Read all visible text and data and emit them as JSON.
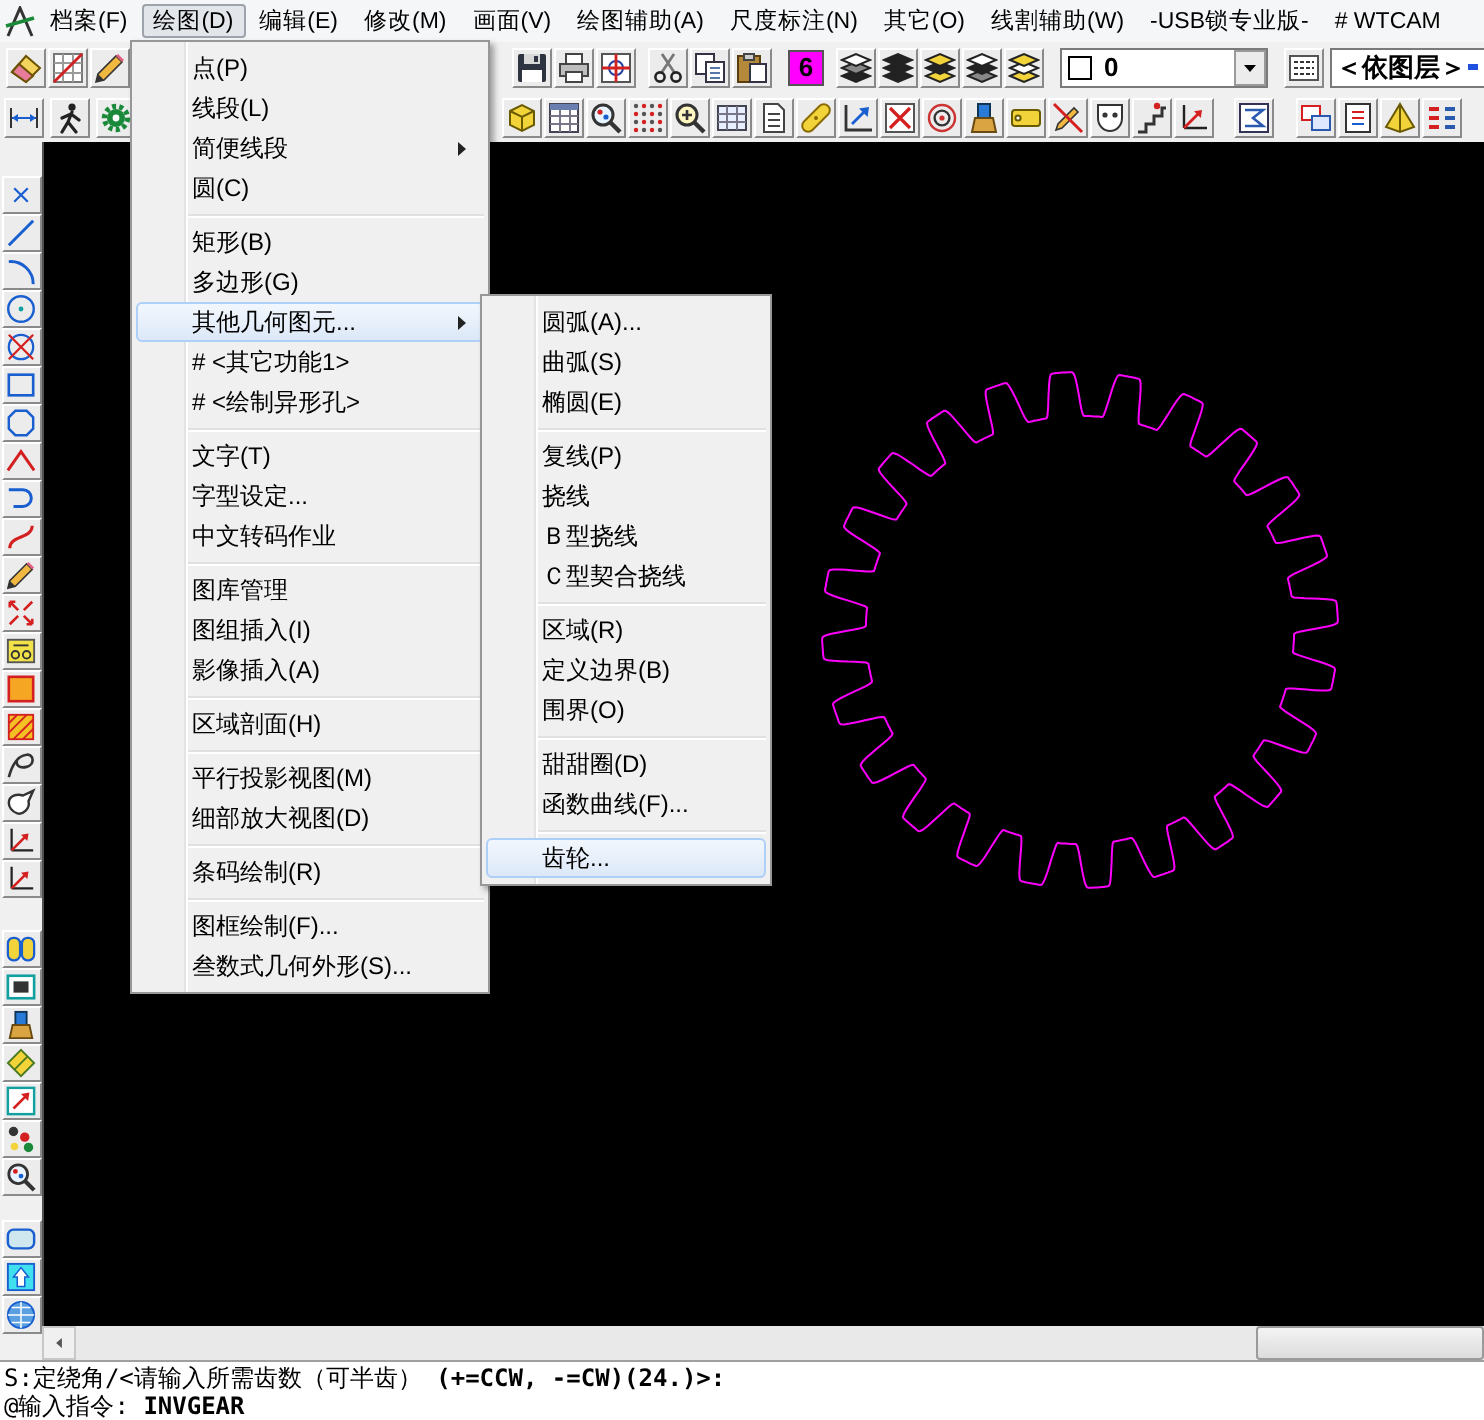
{
  "menu_bar": [
    {
      "label": "档案(F)",
      "selected": false
    },
    {
      "label": "绘图(D)",
      "selected": true
    },
    {
      "label": "编辑(E)",
      "selected": false
    },
    {
      "label": "修改(M)",
      "selected": false
    },
    {
      "label": "画面(V)",
      "selected": false
    },
    {
      "label": "绘图辅助(A)",
      "selected": false
    },
    {
      "label": "尺度标注(N)",
      "selected": false
    },
    {
      "label": "其它(O)",
      "selected": false
    },
    {
      "label": "线割辅助(W)",
      "selected": false
    },
    {
      "label": "-USB锁专业版-",
      "selected": false
    },
    {
      "label": "# WTCAM",
      "selected": false
    }
  ],
  "toolbar": {
    "color_index": {
      "label": "6",
      "color": "#ff00ff"
    },
    "layer_select": {
      "value": "0"
    },
    "linetype_field": {
      "value": "＜依图层＞"
    }
  },
  "drawing_menu": {
    "sections": [
      {
        "items": [
          {
            "label": "点(P)",
            "submenu": false,
            "selected": false
          },
          {
            "label": "线段(L)",
            "submenu": false,
            "selected": false
          },
          {
            "label": "简便线段",
            "submenu": true,
            "selected": false
          },
          {
            "label": "圆(C)",
            "submenu": false,
            "selected": false
          }
        ]
      },
      {
        "items": [
          {
            "label": "矩形(B)",
            "submenu": false,
            "selected": false
          },
          {
            "label": "多边形(G)",
            "submenu": false,
            "selected": false
          },
          {
            "label": "其他几何图元...",
            "submenu": true,
            "selected": true
          },
          {
            "label": "# <其它功能1>",
            "submenu": false,
            "selected": false
          },
          {
            "label": "# <绘制异形孔>",
            "submenu": false,
            "selected": false
          }
        ]
      },
      {
        "items": [
          {
            "label": "文字(T)",
            "submenu": false,
            "selected": false
          },
          {
            "label": "字型设定...",
            "submenu": false,
            "selected": false
          },
          {
            "label": "中文转码作业",
            "submenu": false,
            "selected": false
          }
        ]
      },
      {
        "items": [
          {
            "label": "图库管理",
            "submenu": false,
            "selected": false
          },
          {
            "label": "图组插入(I)",
            "submenu": false,
            "selected": false
          },
          {
            "label": "影像插入(A)",
            "submenu": false,
            "selected": false
          }
        ]
      },
      {
        "items": [
          {
            "label": "区域剖面(H)",
            "submenu": false,
            "selected": false
          }
        ]
      },
      {
        "items": [
          {
            "label": "平行投影视图(M)",
            "submenu": false,
            "selected": false
          },
          {
            "label": "细部放大视图(D)",
            "submenu": false,
            "selected": false
          }
        ]
      },
      {
        "items": [
          {
            "label": "条码绘制(R)",
            "submenu": false,
            "selected": false
          }
        ]
      },
      {
        "items": [
          {
            "label": "图框绘制(F)...",
            "submenu": false,
            "selected": false
          },
          {
            "label": "叁数式几何外形(S)...",
            "submenu": false,
            "selected": false
          }
        ]
      }
    ]
  },
  "submenu": {
    "sections": [
      {
        "items": [
          {
            "label": "圆弧(A)...",
            "selected": false
          },
          {
            "label": "曲弧(S)",
            "selected": false
          },
          {
            "label": "椭圆(E)",
            "selected": false
          }
        ]
      },
      {
        "items": [
          {
            "label": "复线(P)",
            "selected": false
          },
          {
            "label": "挠线",
            "selected": false
          },
          {
            "label": "Ｂ型挠线",
            "selected": false
          },
          {
            "label": "Ｃ型契合挠线",
            "selected": false
          }
        ]
      },
      {
        "items": [
          {
            "label": "区域(R)",
            "selected": false
          },
          {
            "label": "定义边界(B)",
            "selected": false
          },
          {
            "label": "围界(O)",
            "selected": false
          }
        ]
      },
      {
        "items": [
          {
            "label": "甜甜圈(D)",
            "selected": false
          },
          {
            "label": "函数曲线(F)...",
            "selected": false
          }
        ]
      },
      {
        "items": [
          {
            "label": "齿轮...",
            "selected": true
          }
        ]
      }
    ]
  },
  "command_lines": [
    "S:定绕角/<请输入所需齿数（可半齿） **(+=CCW, -=CW)(24.)>:**",
    "@输入指令: **INVGEAR**"
  ]
}
